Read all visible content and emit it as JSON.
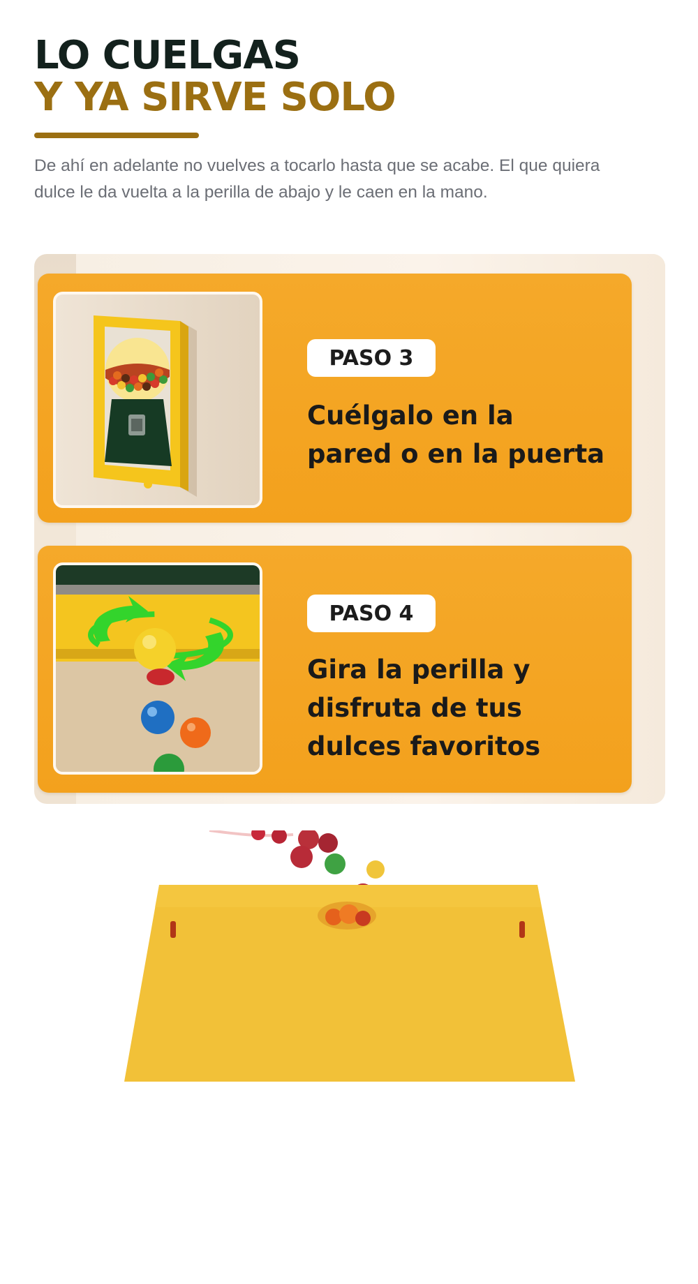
{
  "hero": {
    "title_line1": "LO CUELGAS",
    "title_line2": "Y YA SIRVE SOLO",
    "paragraph": "De ahí en adelante no vuelves a tocarlo hasta que se acabe. El que quiera dulce le da vuelta a la perilla de abajo y le caen en la mano."
  },
  "steps": [
    {
      "badge": "PASO 3",
      "text_line1": "Cuélgalo en la",
      "text_line2": "pared o en la puerta"
    },
    {
      "badge": "PASO 4",
      "text_line1": "Gira la perilla y",
      "text_line2": "disfruta de tus",
      "text_line3": "dulces favoritos"
    }
  ],
  "colors": {
    "title_dark": "#13211d",
    "title_gold": "#9b6f12",
    "card_orange": "#f3a11d",
    "frame_yellow": "#f5c51c"
  }
}
